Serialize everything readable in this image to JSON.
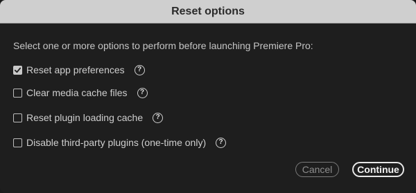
{
  "dialog": {
    "title": "Reset options",
    "instruction": "Select one or more options to perform before launching Premiere Pro:",
    "options": [
      {
        "label": "Reset app preferences",
        "checked": true
      },
      {
        "label": "Clear media cache files",
        "checked": false
      },
      {
        "label": "Reset plugin loading cache",
        "checked": false
      },
      {
        "label": "Disable third-party plugins (one-time only)",
        "checked": false
      }
    ],
    "help_glyph": "?",
    "buttons": {
      "cancel": "Cancel",
      "continue": "Continue"
    }
  }
}
